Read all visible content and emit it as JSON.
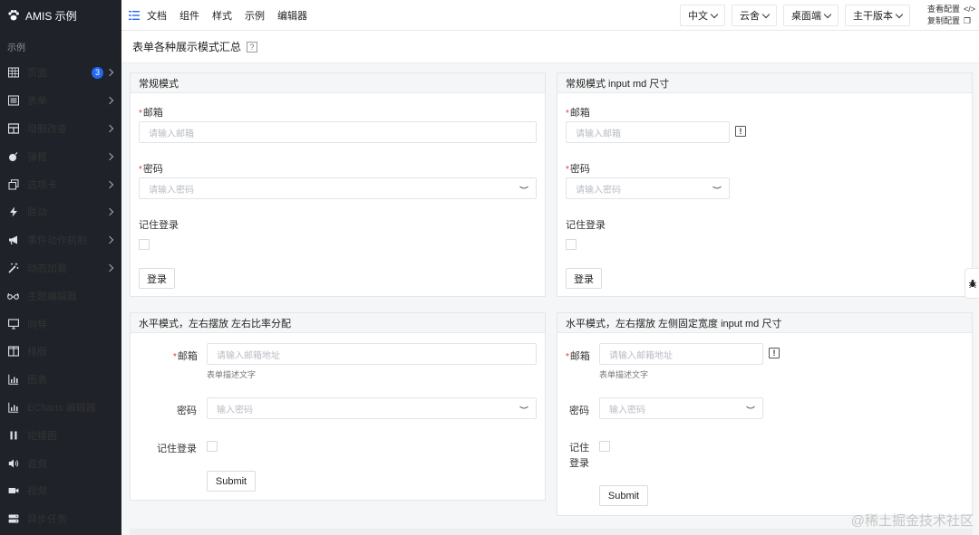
{
  "app": {
    "title": "AMIS 示例"
  },
  "sidebar": {
    "section": "示例",
    "items": [
      {
        "label": "页面",
        "icon": "table-icon",
        "badge": "3",
        "has_children": true
      },
      {
        "label": "表单",
        "icon": "list-icon",
        "has_children": true
      },
      {
        "label": "增删改查",
        "icon": "grid-icon",
        "has_children": true
      },
      {
        "label": "弹框",
        "icon": "bomb-icon",
        "has_children": true
      },
      {
        "label": "选项卡",
        "icon": "clone-icon",
        "has_children": true
      },
      {
        "label": "联动",
        "icon": "bolt-icon",
        "has_children": true
      },
      {
        "label": "事件动作机制",
        "icon": "bullhorn-icon",
        "has_children": true
      },
      {
        "label": "动态加载",
        "icon": "magic-icon",
        "has_children": true
      },
      {
        "label": "主题编辑器",
        "icon": "glasses-icon",
        "has_children": false
      },
      {
        "label": "向导",
        "icon": "desktop-icon",
        "has_children": false
      },
      {
        "label": "排版",
        "icon": "columns-icon",
        "has_children": false
      },
      {
        "label": "图表",
        "icon": "chart-icon",
        "has_children": false
      },
      {
        "label": "ECharts 编辑器",
        "icon": "chart-icon",
        "has_children": false
      },
      {
        "label": "轮播图",
        "icon": "pause-icon",
        "has_children": false
      },
      {
        "label": "音频",
        "icon": "volume-icon",
        "has_children": false
      },
      {
        "label": "视频",
        "icon": "video-icon",
        "has_children": false
      },
      {
        "label": "异步任务",
        "icon": "server-icon",
        "has_children": false
      }
    ]
  },
  "topbar": {
    "links": [
      "文档",
      "组件",
      "样式",
      "示例",
      "编辑器"
    ],
    "selects": [
      "中文",
      "云舍",
      "桌面端",
      "主干版本"
    ],
    "view_config": "查看配置",
    "copy_config": "复制配置"
  },
  "page": {
    "title": "表单各种展示模式汇总",
    "help": "?"
  },
  "panels": {
    "normal": {
      "title": "常规模式",
      "email_label": "邮箱",
      "email_placeholder": "请输入邮箱",
      "password_label": "密码",
      "password_placeholder": "请输入密码",
      "remember_label": "记住登录",
      "submit": "登录"
    },
    "normal_md": {
      "title": "常规模式 input md 尺寸",
      "email_label": "邮箱",
      "email_placeholder": "请输入邮箱",
      "password_label": "密码",
      "password_placeholder": "请输入密码",
      "remember_label": "记住登录",
      "submit": "登录"
    },
    "horizontal": {
      "title": "水平模式，左右摆放 左右比率分配",
      "email_label": "邮箱",
      "email_placeholder": "请输入邮箱地址",
      "email_desc": "表单描述文字",
      "password_label": "密码",
      "password_placeholder": "输入密码",
      "remember_label": "记住登录",
      "submit": "Submit"
    },
    "horizontal_fixed": {
      "title": "水平模式，左右摆放 左侧固定宽度 input md 尺寸",
      "email_label": "邮箱",
      "email_placeholder": "请输入邮箱地址",
      "email_desc": "表单描述文字",
      "password_label": "密码",
      "password_placeholder": "输入密码",
      "remember_label_1": "记住",
      "remember_label_2": "登录",
      "submit": "Submit"
    }
  },
  "watermark": "@稀土掘金技术社区"
}
